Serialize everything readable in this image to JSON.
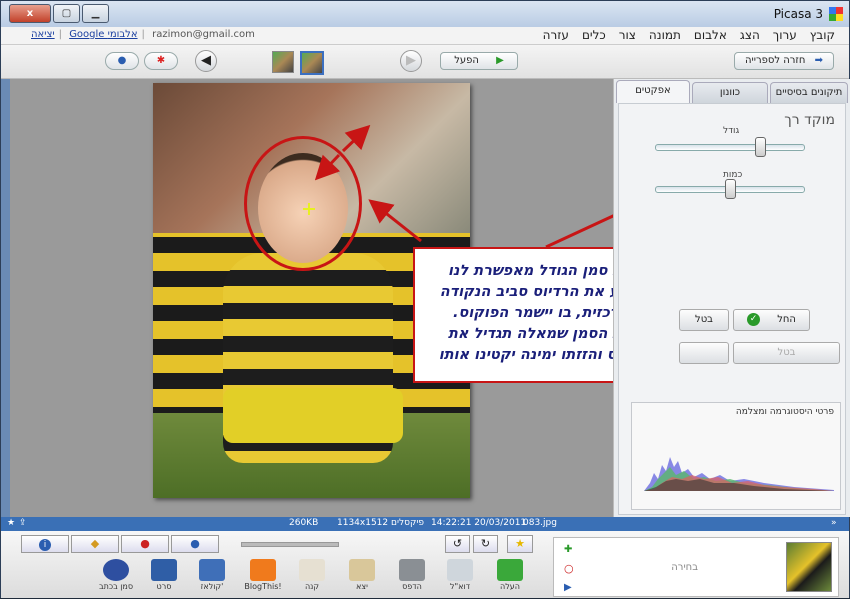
{
  "titlebar": {
    "app_title": "Picasa 3",
    "minimize": "▁",
    "maximize": "▢",
    "close": "x"
  },
  "menu": {
    "items": [
      "קובץ",
      "ערוך",
      "הצג",
      "אלבום",
      "תמונה",
      "צור",
      "כלים",
      "עזרה"
    ]
  },
  "account": {
    "email": "razimon@gmail.com",
    "web_albums": "Google אלבומי",
    "sign_out": "יציאה"
  },
  "toolbar": {
    "back_to_library": "חזרה לספרייה",
    "play": "הפעל"
  },
  "panel": {
    "tabs": [
      "תיקונים בסיסיים",
      "כוונון",
      "אפקטים"
    ],
    "active_tab": "אפקטים",
    "effect_title": "מוקד רך",
    "size_label": "גודל",
    "amount_label": "כמות",
    "size_value": 0.7,
    "amount_value": 0.5,
    "apply_button": "החל",
    "cancel_button": "בטל",
    "cancel_button_2": "בטל",
    "histogram_title": "פרטי היסטוגרמה ומצלמה"
  },
  "callout": {
    "lines": [
      "הזזת סמן הגודל מאפשרת לנו",
      "לקבוע את הרדיוס סביב הנקודה",
      "המרכזית, בו יישמר הפוקוס.",
      "הזזת הסמן שמאלה תגדיל את",
      "הרדיוס והזזתו ימינה יקטינו אותו"
    ]
  },
  "status": {
    "filename": "083.jpg",
    "datetime": "14:22:21 20/03/2011",
    "dimensions": "1134x1512 פיקסלים",
    "filesize": "260KB"
  },
  "bottom": {
    "tray_label": "בחירה",
    "tools": [
      {
        "label": "העלה",
        "color": "#3aa83a"
      },
      {
        "label": "דוא\"ל",
        "color": "#cfd6dc"
      },
      {
        "label": "הדפס",
        "color": "#8a8f94"
      },
      {
        "label": "יצא",
        "color": "#d9c79a"
      },
      {
        "label": "קנה",
        "color": "#e6e0d2"
      },
      {
        "label": "BlogThis!",
        "color": "#f07a1c"
      },
      {
        "label": "קולאז'",
        "color": "#3f6fb8"
      },
      {
        "label": "סרט",
        "color": "#2f5ea6"
      },
      {
        "label": "סמן בכתב",
        "color": "#2e4fa0"
      }
    ]
  },
  "icons": [
    "globe-icon",
    "map-pin-icon",
    "back-arrow-icon",
    "forward-arrow-icon",
    "play-icon",
    "check-icon",
    "rotate-left-icon",
    "rotate-right-icon",
    "star-icon",
    "info-icon",
    "tag-icon",
    "location-icon",
    "person-icon"
  ]
}
